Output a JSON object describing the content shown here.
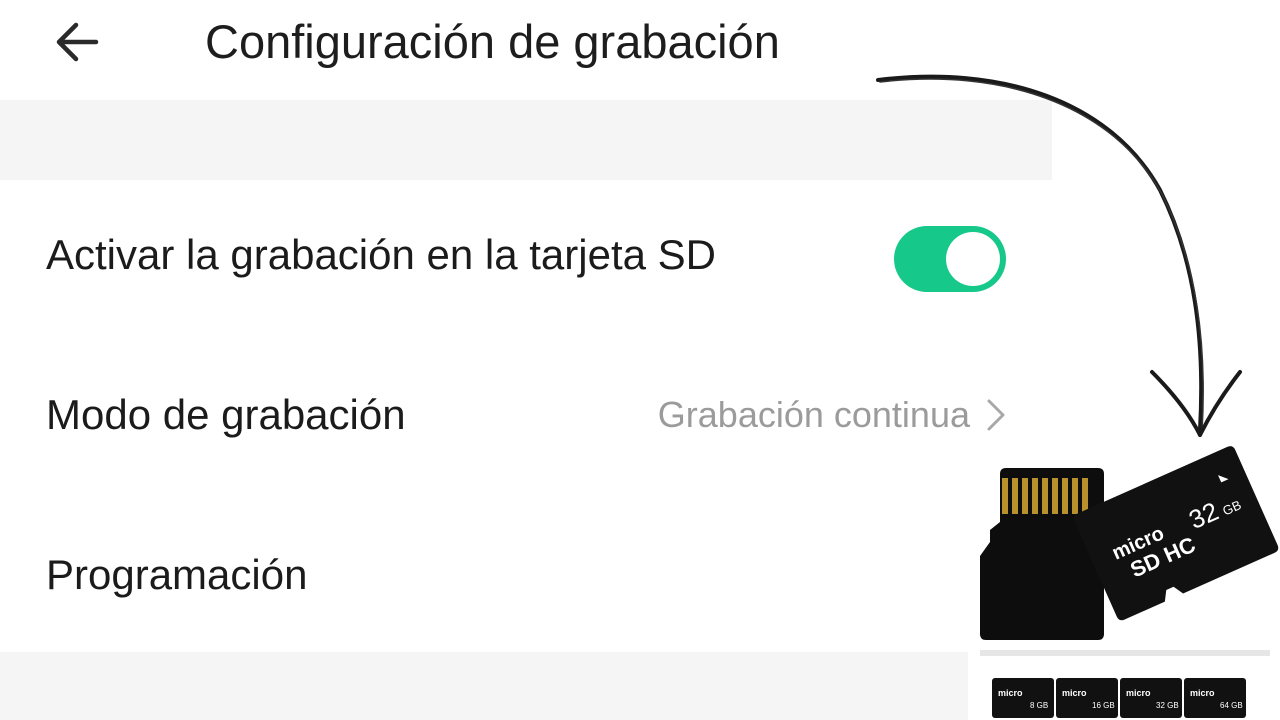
{
  "header": {
    "title": "Configuración de grabación"
  },
  "settings": {
    "sd_recording": {
      "label": "Activar la grabación en la tarjeta SD",
      "enabled": true,
      "toggle_color": "#16c88a"
    },
    "recording_mode": {
      "label": "Modo de grabación",
      "value": "Grabación continua"
    },
    "schedule": {
      "label": "Programación"
    }
  },
  "sd_card_image": {
    "brand_text": "micro SD HC",
    "capacity": "32 GB",
    "thumbnails": [
      "8 GB",
      "16 GB",
      "32 GB",
      "64 GB"
    ]
  },
  "colors": {
    "accent": "#16c88a",
    "secondary_text": "#9b9b9b",
    "section_gap": "#f5f5f5"
  },
  "icons": {
    "back": "arrow-left-icon",
    "chevron": "chevron-right-icon",
    "overlay_arrow": "curved-arrow-icon"
  }
}
